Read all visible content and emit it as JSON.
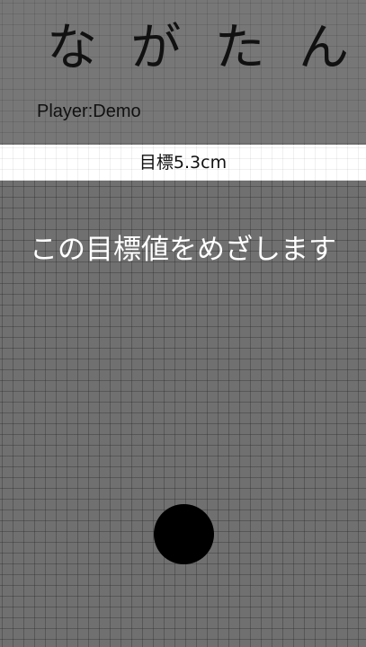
{
  "app": {
    "title_chars": [
      "な",
      "が",
      "た",
      "ん"
    ]
  },
  "player": {
    "label": "Player:Demo"
  },
  "target": {
    "label": "目標5.3cm"
  },
  "message": {
    "text": "この目標値をめざします"
  },
  "colors": {
    "background": "#707070",
    "banner": "#ffffff",
    "ball": "#000000",
    "message_text": "#ffffff"
  }
}
